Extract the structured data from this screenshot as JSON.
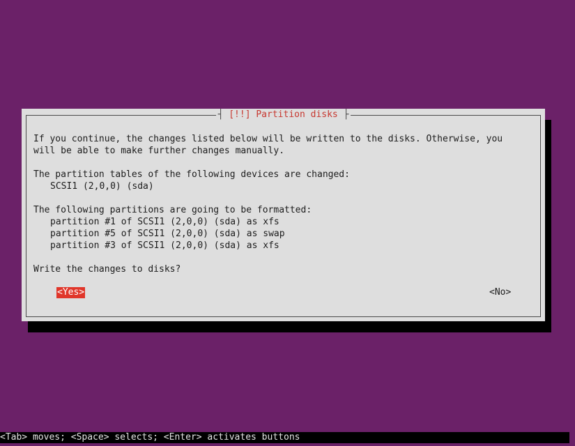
{
  "dialog": {
    "title": "[!!] Partition disks",
    "intro_line1": "If you continue, the changes listed below will be written to the disks. Otherwise, you",
    "intro_line2": "will be able to make further changes manually.",
    "tables_heading": "The partition tables of the following devices are changed:",
    "devices": [
      "SCSI1 (2,0,0) (sda)"
    ],
    "format_heading": "The following partitions are going to be formatted:",
    "partitions": [
      "partition #1 of SCSI1 (2,0,0) (sda) as xfs",
      "partition #5 of SCSI1 (2,0,0) (sda) as swap",
      "partition #3 of SCSI1 (2,0,0) (sda) as xfs"
    ],
    "question": "Write the changes to disks?",
    "yes_label": "<Yes>",
    "no_label": "<No>"
  },
  "statusbar": {
    "help_text": "<Tab> moves; <Space> selects; <Enter> activates buttons"
  },
  "colors": {
    "background": "#6b2168",
    "dialog": "#dedede",
    "accent": "#e0362a",
    "title_text": "#c7372f"
  }
}
